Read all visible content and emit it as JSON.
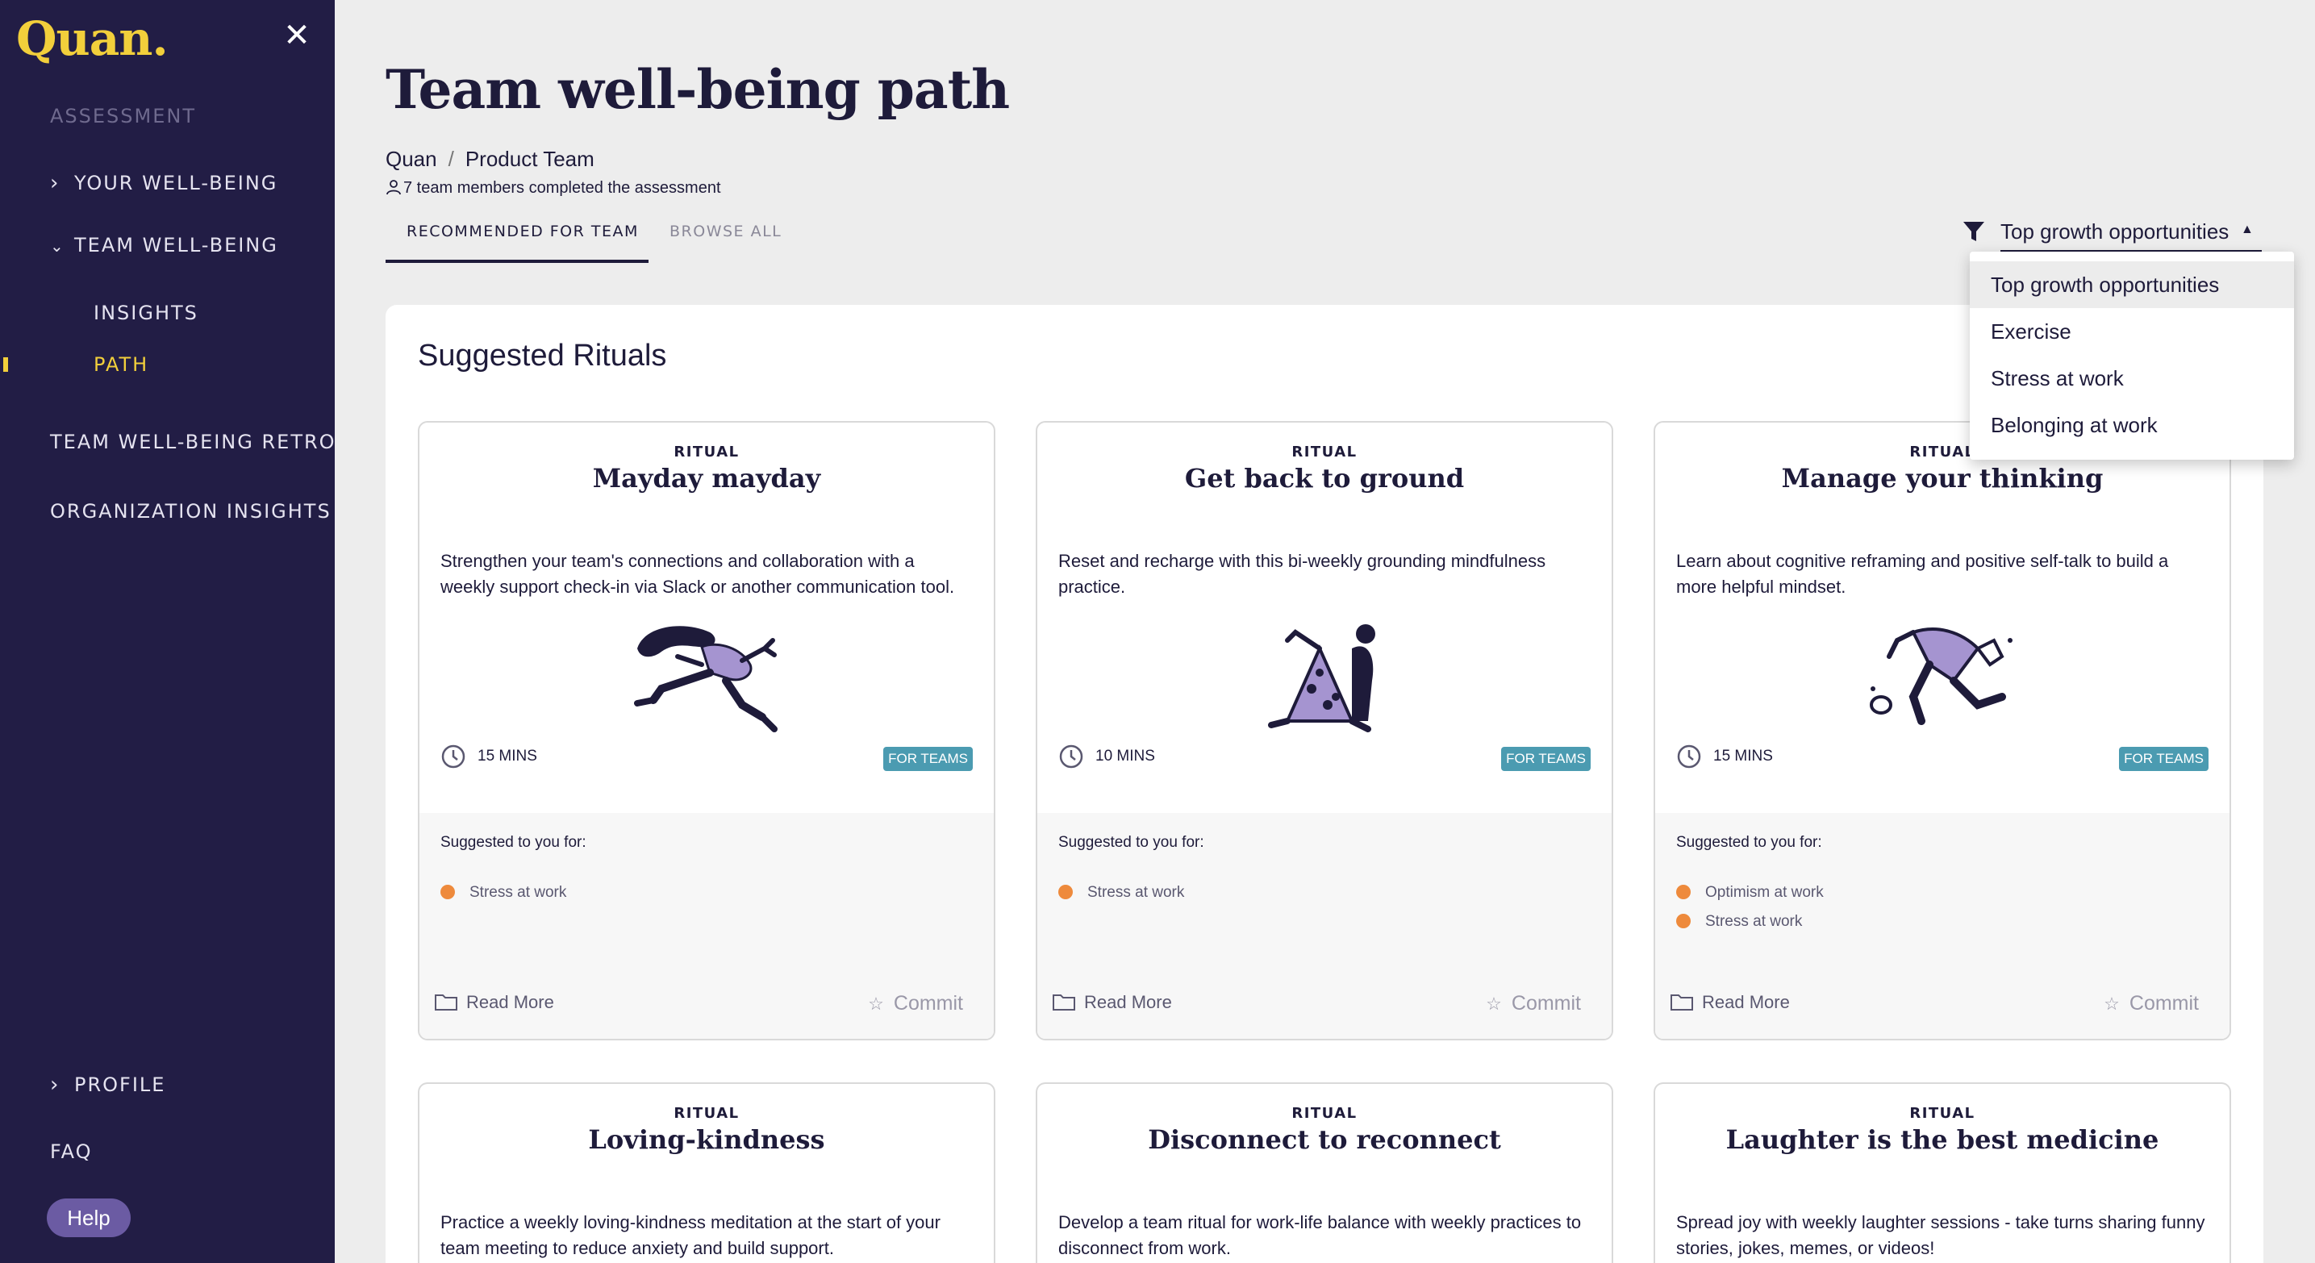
{
  "sidebar": {
    "logo": "Quan.",
    "assessment": "ASSESSMENT",
    "your_wellbeing": "YOUR WELL-BEING",
    "team_wellbeing": "TEAM WELL-BEING",
    "insights": "INSIGHTS",
    "path": "PATH",
    "team_retro": "TEAM WELL-BEING RETRO",
    "org_insights": "ORGANIZATION INSIGHTS",
    "profile": "PROFILE",
    "faq": "FAQ",
    "help": "Help"
  },
  "header": {
    "title": "Team well-being path",
    "breadcrumb": [
      "Quan",
      "Product Team"
    ],
    "members_note": "7 team members completed the assessment"
  },
  "tabs": [
    "RECOMMENDED FOR TEAM",
    "BROWSE ALL"
  ],
  "filter": {
    "selected": "Top growth opportunities",
    "options": [
      "Top growth opportunities",
      "Exercise",
      "Stress at work",
      "Belonging at work"
    ]
  },
  "section_title": "Suggested Rituals",
  "common": {
    "type_label": "RITUAL",
    "for_teams": "FOR TEAMS",
    "suggested_label": "Suggested to you for:",
    "read_more": "Read More",
    "commit": "Commit"
  },
  "cards": [
    {
      "title": "Mayday mayday",
      "description": "Strengthen your team's connections and collaboration with a weekly support check-in via Slack or another communication tool.",
      "duration": "15 MINS",
      "suggested_for": [
        "Stress at work"
      ]
    },
    {
      "title": "Get back to ground",
      "description": "Reset and recharge with this bi-weekly grounding mindfulness practice.",
      "duration": "10 MINS",
      "suggested_for": [
        "Stress at work"
      ]
    },
    {
      "title": "Manage your thinking",
      "description": "Learn about cognitive reframing and positive self-talk to build a more helpful mindset.",
      "duration": "15 MINS",
      "suggested_for": [
        "Optimism at work",
        "Stress at work"
      ]
    },
    {
      "title": "Loving-kindness",
      "description": "Practice a weekly loving-kindness meditation at the start of your team meeting to reduce anxiety and build support."
    },
    {
      "title": "Disconnect to reconnect",
      "description": "Develop a team ritual for work-life balance with weekly practices to disconnect from work."
    },
    {
      "title": "Laughter is the best medicine",
      "description": "Spread joy with weekly laughter sessions - take turns sharing funny stories, jokes, memes, or videos!"
    }
  ],
  "colors": {
    "sidebar_bg": "#221d45",
    "accent_yellow": "#f2cf3b",
    "badge_teal": "#4b9bb1",
    "dot_orange": "#ee8a3c",
    "help_purple": "#6b5ba3"
  }
}
